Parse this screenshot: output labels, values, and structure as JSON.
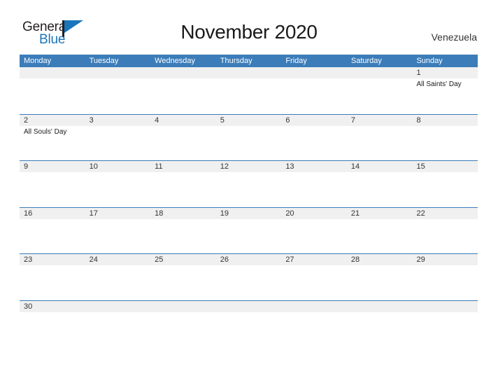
{
  "brand": {
    "name_top": "General",
    "name_bottom": "Blue",
    "flag_icon": "flag-icon",
    "color_dark": "#231f20",
    "color_blue": "#1b75bb"
  },
  "header": {
    "title": "November 2020",
    "region": "Venezuela"
  },
  "theme": {
    "header_blue": "#3b7cb9",
    "band_gray": "#f0f0f0",
    "text_dark": "#333333"
  },
  "calendar": {
    "weekday_headers": [
      "Monday",
      "Tuesday",
      "Wednesday",
      "Thursday",
      "Friday",
      "Saturday",
      "Sunday"
    ],
    "weeks": [
      [
        {
          "day": "",
          "events": []
        },
        {
          "day": "",
          "events": []
        },
        {
          "day": "",
          "events": []
        },
        {
          "day": "",
          "events": []
        },
        {
          "day": "",
          "events": []
        },
        {
          "day": "",
          "events": []
        },
        {
          "day": "1",
          "events": [
            "All Saints' Day"
          ]
        }
      ],
      [
        {
          "day": "2",
          "events": [
            "All Souls' Day"
          ]
        },
        {
          "day": "3",
          "events": []
        },
        {
          "day": "4",
          "events": []
        },
        {
          "day": "5",
          "events": []
        },
        {
          "day": "6",
          "events": []
        },
        {
          "day": "7",
          "events": []
        },
        {
          "day": "8",
          "events": []
        }
      ],
      [
        {
          "day": "9",
          "events": []
        },
        {
          "day": "10",
          "events": []
        },
        {
          "day": "11",
          "events": []
        },
        {
          "day": "12",
          "events": []
        },
        {
          "day": "13",
          "events": []
        },
        {
          "day": "14",
          "events": []
        },
        {
          "day": "15",
          "events": []
        }
      ],
      [
        {
          "day": "16",
          "events": []
        },
        {
          "day": "17",
          "events": []
        },
        {
          "day": "18",
          "events": []
        },
        {
          "day": "19",
          "events": []
        },
        {
          "day": "20",
          "events": []
        },
        {
          "day": "21",
          "events": []
        },
        {
          "day": "22",
          "events": []
        }
      ],
      [
        {
          "day": "23",
          "events": []
        },
        {
          "day": "24",
          "events": []
        },
        {
          "day": "25",
          "events": []
        },
        {
          "day": "26",
          "events": []
        },
        {
          "day": "27",
          "events": []
        },
        {
          "day": "28",
          "events": []
        },
        {
          "day": "29",
          "events": []
        }
      ],
      [
        {
          "day": "30",
          "events": []
        },
        {
          "day": "",
          "events": []
        },
        {
          "day": "",
          "events": []
        },
        {
          "day": "",
          "events": []
        },
        {
          "day": "",
          "events": []
        },
        {
          "day": "",
          "events": []
        },
        {
          "day": "",
          "events": []
        }
      ]
    ]
  }
}
